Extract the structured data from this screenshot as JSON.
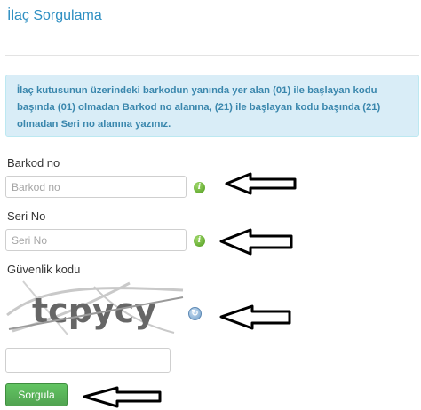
{
  "page": {
    "title": "İlaç Sorgulama",
    "info_text": "İlaç kutusunun üzerindeki barkodun yanında yer alan (01) ile başlayan kodu başında (01) olmadan Barkod no alanına, (21) ile başlayan kodu başında (21) olmadan Seri no alanına yazınız."
  },
  "form": {
    "barcode_label": "Barkod no",
    "barcode_placeholder": "Barkod no",
    "serial_label": "Seri No",
    "serial_placeholder": "Seri No",
    "security_label": "Güvenlik kodu",
    "captcha_text": "tcpycy",
    "security_value": "",
    "submit_label": "Sorgula"
  },
  "icons": {
    "info": "info-icon",
    "refresh": "refresh-icon",
    "arrow": "arrow-left-icon"
  },
  "colors": {
    "title": "#2e8fc2",
    "alert_bg": "#d9edf7",
    "alert_text": "#3a87ad",
    "button": "#5bb75b"
  }
}
